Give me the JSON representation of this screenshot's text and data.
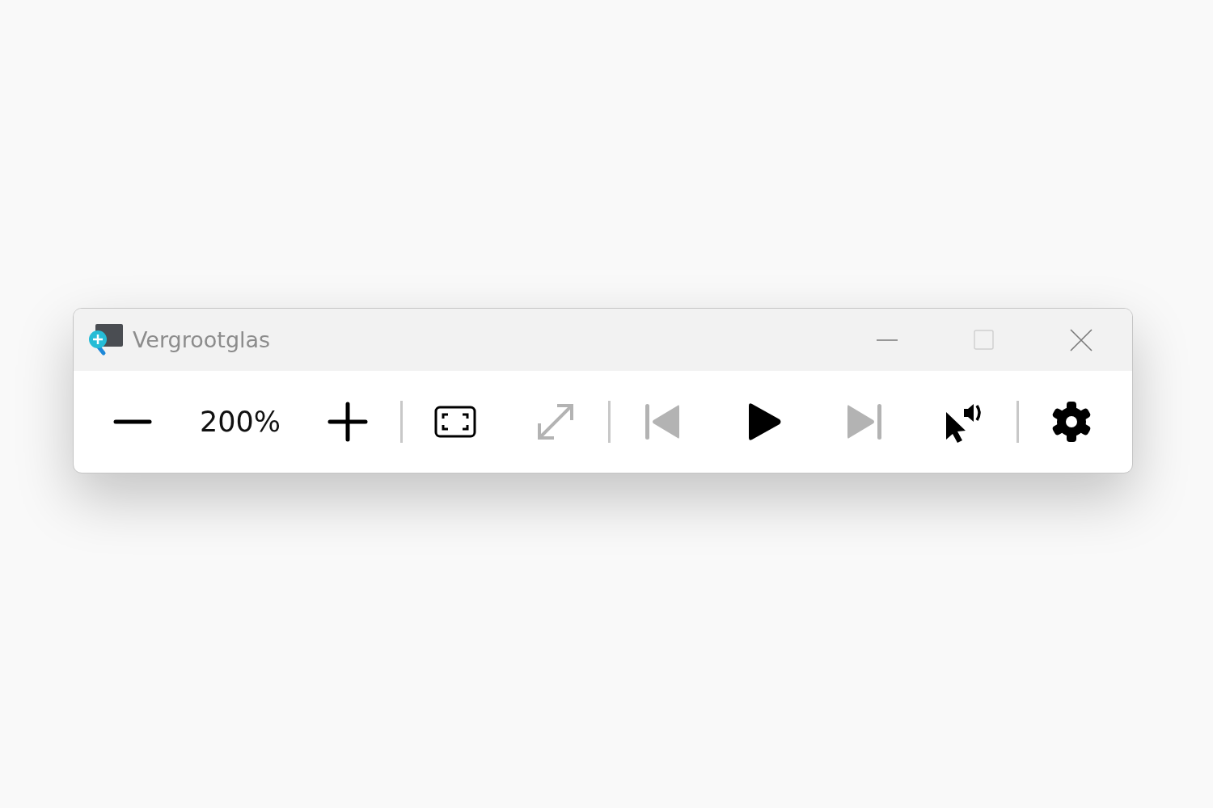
{
  "window": {
    "title": "Vergrootglas"
  },
  "toolbar": [
    {
      "kind": "zoom-out",
      "disabled": false
    },
    {
      "kind": "zoom-level",
      "text": "200%"
    },
    {
      "kind": "zoom-in",
      "disabled": false
    },
    {
      "kind": "separator"
    },
    {
      "kind": "fullscreen",
      "disabled": false
    },
    {
      "kind": "resize",
      "disabled": true
    },
    {
      "kind": "separator"
    },
    {
      "kind": "previous",
      "disabled": true
    },
    {
      "kind": "play",
      "disabled": false
    },
    {
      "kind": "next",
      "disabled": true
    },
    {
      "kind": "read-from-pointer",
      "disabled": false
    },
    {
      "kind": "separator"
    },
    {
      "kind": "settings",
      "disabled": false
    }
  ]
}
